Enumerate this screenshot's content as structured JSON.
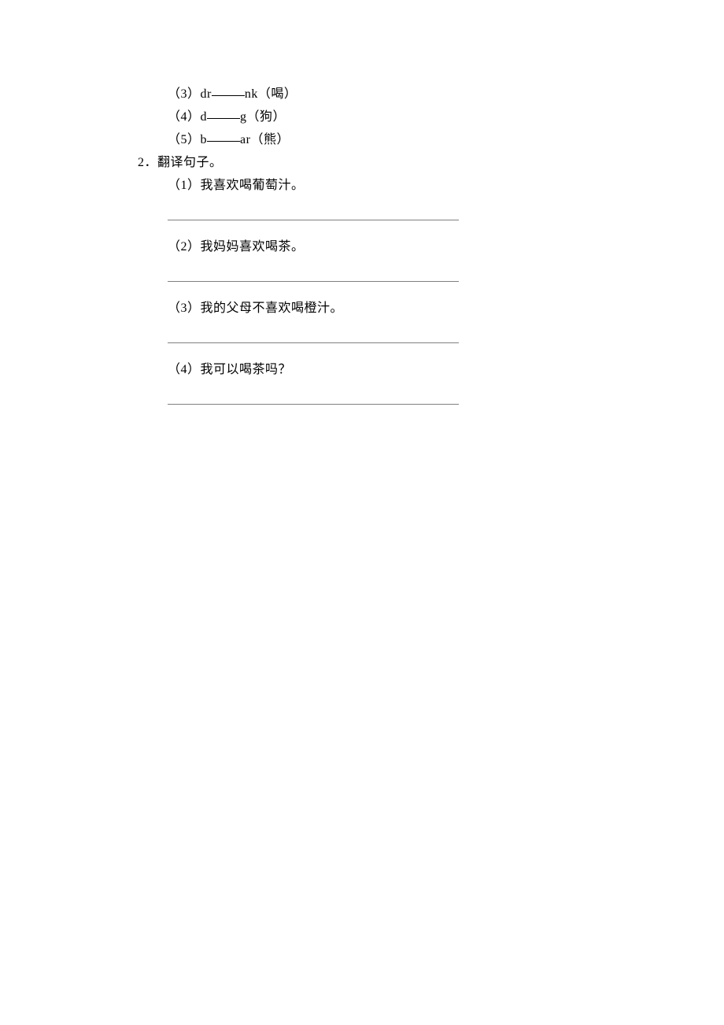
{
  "items": {
    "fill_3": {
      "num": "（3）",
      "prefix": "dr",
      "suffix": "nk",
      "hint": "（喝）"
    },
    "fill_4": {
      "num": "（4）",
      "prefix": "d",
      "suffix": "g",
      "hint": "（狗）"
    },
    "fill_5": {
      "num": "（5）",
      "prefix": "b",
      "suffix": "ar",
      "hint": "（熊）"
    }
  },
  "section2": {
    "num": "2．",
    "title": "翻译句子。",
    "q1": {
      "num": "（1）",
      "text": "我喜欢喝葡萄汁。"
    },
    "q2": {
      "num": "（2）",
      "text": "我妈妈喜欢喝茶。"
    },
    "q3": {
      "num": "（3）",
      "text": "我的父母不喜欢喝橙汁。"
    },
    "q4": {
      "num": "（4）",
      "text": "我可以喝茶吗？"
    }
  }
}
